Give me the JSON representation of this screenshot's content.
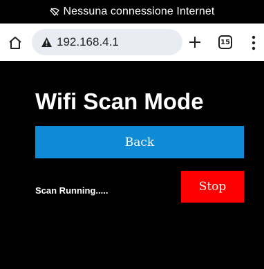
{
  "status_bar": {
    "network_status": "Nessuna connessione Internet",
    "icon": "wifi-off-icon"
  },
  "browser": {
    "url": "192.168.4.1",
    "tab_count": "15",
    "icons": [
      "home-icon",
      "not-secure-warning-icon",
      "new-tab-plus-icon",
      "tab-switcher-icon",
      "overflow-menu-icon"
    ]
  },
  "page": {
    "title": "Wifi Scan Mode",
    "back_label": "Back",
    "scan_status": "Scan Running.....",
    "stop_label": "Stop"
  },
  "colors": {
    "background": "#000000",
    "back_button": "#0f8ad6",
    "stop_button": "#ff0000",
    "text": "#ffffff",
    "url_pill": "#e9edf3"
  }
}
